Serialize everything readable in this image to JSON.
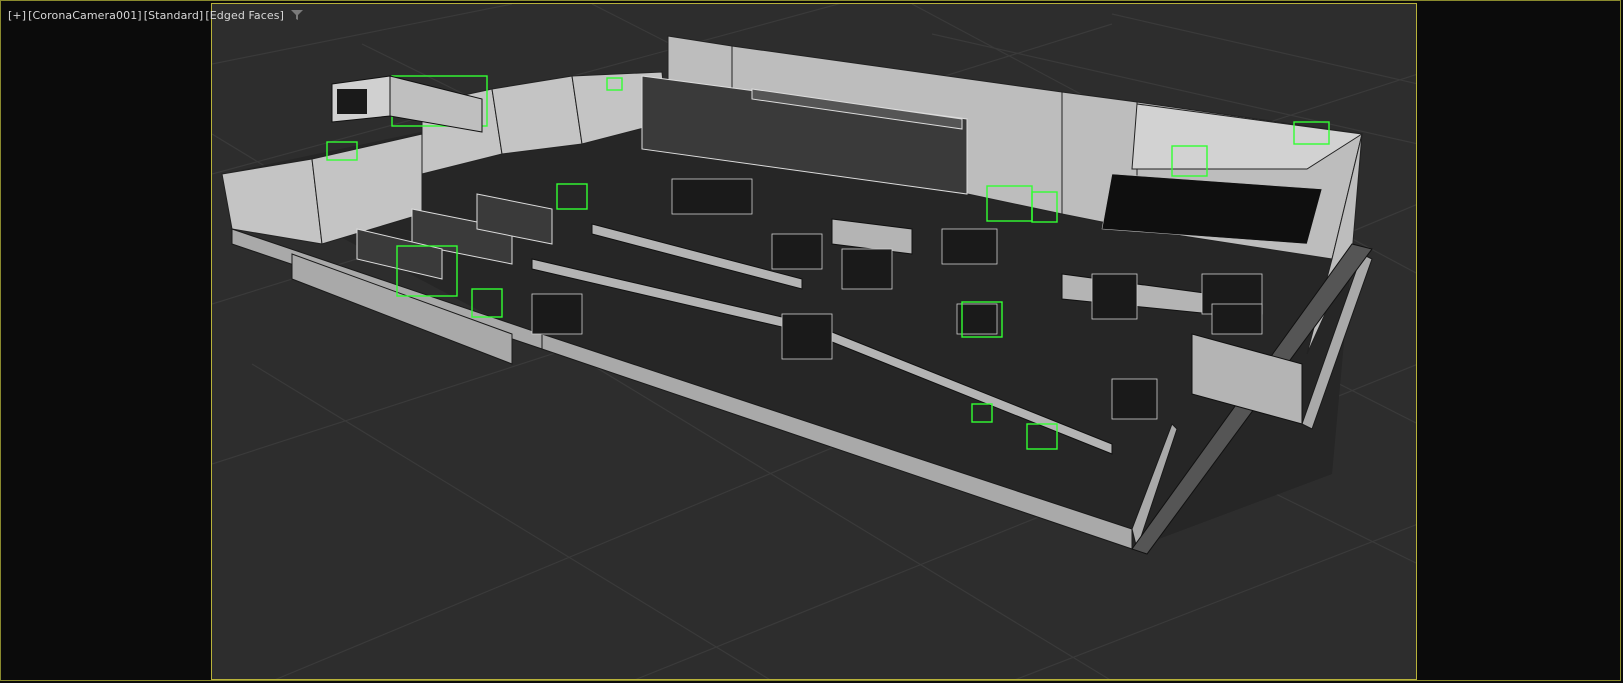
{
  "viewport": {
    "label": {
      "menu": "[+]",
      "camera": "[CoronaCamera001]",
      "shading_mode": "[Standard]",
      "display_mode": "[Edged Faces]"
    },
    "filter_icon": "filter-icon"
  },
  "colors": {
    "frame_border": "#8a8a2e",
    "safe_frame_border": "#b8b23a",
    "ground": "#2d2d2d",
    "grid_line": "#3a3a3a",
    "selection": "#33ff33",
    "wall": "#c9c9c9",
    "machine": "#1a1a1a"
  }
}
